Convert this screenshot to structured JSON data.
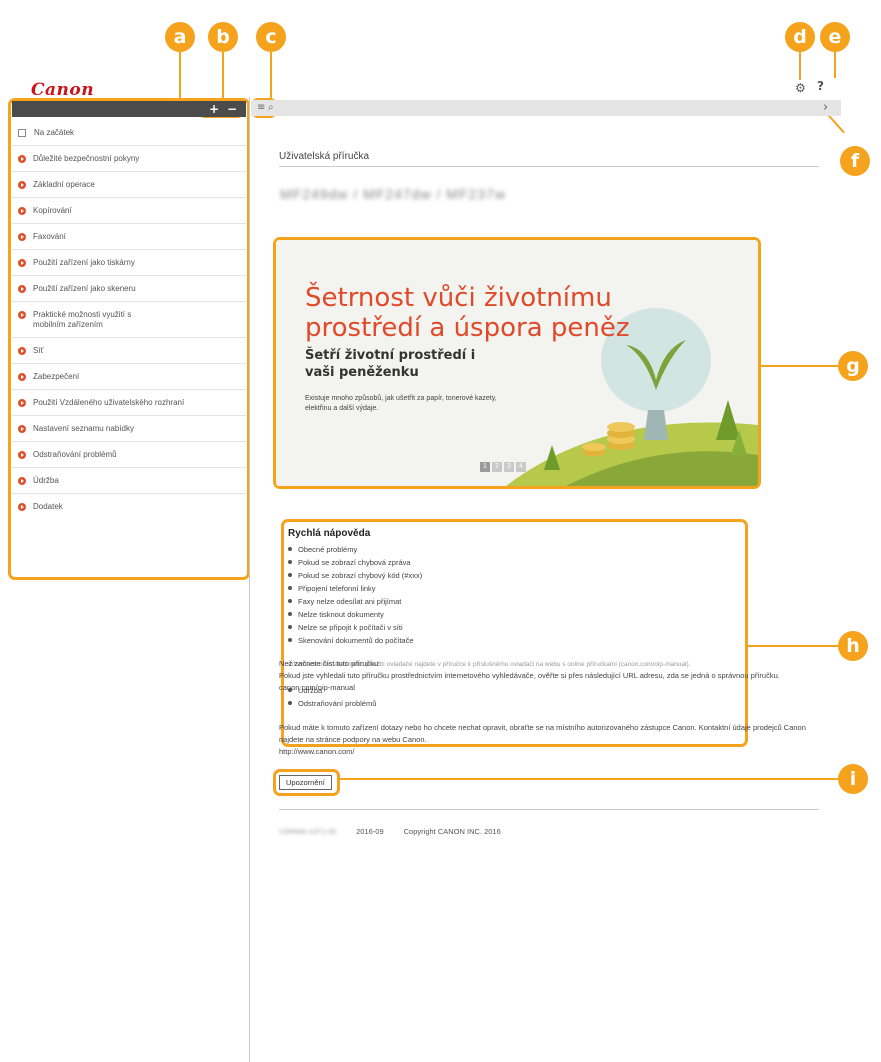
{
  "logo": "Canon",
  "callouts": [
    "a",
    "b",
    "c",
    "d",
    "e",
    "f",
    "g",
    "h",
    "i"
  ],
  "sidebar": {
    "expand_icon": "+",
    "collapse_icon": "−",
    "items": [
      {
        "label": "Na začátek",
        "icon": "document-icon"
      },
      {
        "label": "Důležité bezpečnostní pokyny",
        "icon": "arrow-bullet-icon"
      },
      {
        "label": "Základní operace",
        "icon": "arrow-bullet-icon"
      },
      {
        "label": "Kopírování",
        "icon": "arrow-bullet-icon"
      },
      {
        "label": "Faxování",
        "icon": "arrow-bullet-icon"
      },
      {
        "label": "Použití zařízení jako tiskárny",
        "icon": "arrow-bullet-icon"
      },
      {
        "label": "Použití zařízení jako skeneru",
        "icon": "arrow-bullet-icon"
      },
      {
        "label": "Praktické možnosti využití s mobilním zařízením",
        "icon": "arrow-bullet-icon"
      },
      {
        "label": "Síť",
        "icon": "arrow-bullet-icon"
      },
      {
        "label": "Zabezpečení",
        "icon": "arrow-bullet-icon"
      },
      {
        "label": "Použití Vzdáleného uživatelského rozhraní",
        "icon": "arrow-bullet-icon"
      },
      {
        "label": "Nastavení seznamu nabídky",
        "icon": "arrow-bullet-icon"
      },
      {
        "label": "Odstraňování problémů",
        "icon": "arrow-bullet-icon"
      },
      {
        "label": "Údržba",
        "icon": "arrow-bullet-icon"
      },
      {
        "label": "Dodatek",
        "icon": "arrow-bullet-icon"
      }
    ]
  },
  "toolbar": {
    "list_icon": "≡",
    "search_icon": "⌕",
    "next_icon": "›"
  },
  "header": {
    "settings_icon": "⚙",
    "help_icon": "?"
  },
  "main": {
    "title": "Uživatelská příručka",
    "model": "MF249dw / MF247dw / MF237w",
    "banner": {
      "title": "Šetrnost vůči životnímu prostředí a úspora peněz",
      "subtitle": "Šetří životní prostředí i vaši peněženku",
      "text": "Existuje mnoho způsobů, jak ušetřit za papír, tonerové kazety, elektřinu a další výdaje.",
      "pages": [
        "1",
        "2",
        "3",
        "4"
      ]
    },
    "quick_help": {
      "heading": "Rychlá nápověda",
      "items": [
        "Obecné problémy",
        "Pokud se zobrazí chybová zpráva",
        "Pokud se zobrazí chybový kód (#xxx)",
        "Připojení telefonní linky",
        "Faxy nelze odesílat ani přijímat",
        "Nelze tisknout dokumenty",
        "Nelze se připojit k počítači v síti",
        "Skenování dokumentů do počítače"
      ],
      "note": "Informace o instalaci nebo použití ovladače najdete v příručce k příslušnému ovladači na webu s online příručkami (canon.com/oip-manual).",
      "extra_items": [
        "Údržba",
        "Odstraňování problémů"
      ]
    },
    "info1": [
      "Než začnete číst tuto příručku:",
      "Pokud jste vyhledali tuto příručku prostřednictvím internetového vyhledávače, ověřte si přes následující URL adresu, zda se jedná o správnou příručku.",
      "canon.com/oip-manual"
    ],
    "info2": [
      "Pokud máte k tomuto zařízení dotazy nebo ho chcete nechat opravit, obraťte se na místního autorizovaného zástupce Canon. Kontaktní údaje prodejců Canon najdete na stránce podpory na webu Canon.",
      "http://www.canon.com/"
    ],
    "notice_button": "Upozornění",
    "footer": {
      "code": "USRMA-1371-00",
      "date": "2016-09",
      "copyright": "Copyright CANON INC. 2016"
    }
  },
  "colors": {
    "accent": "#f5a21c",
    "brand": "#c9141b",
    "bullet": "#e0502a"
  }
}
